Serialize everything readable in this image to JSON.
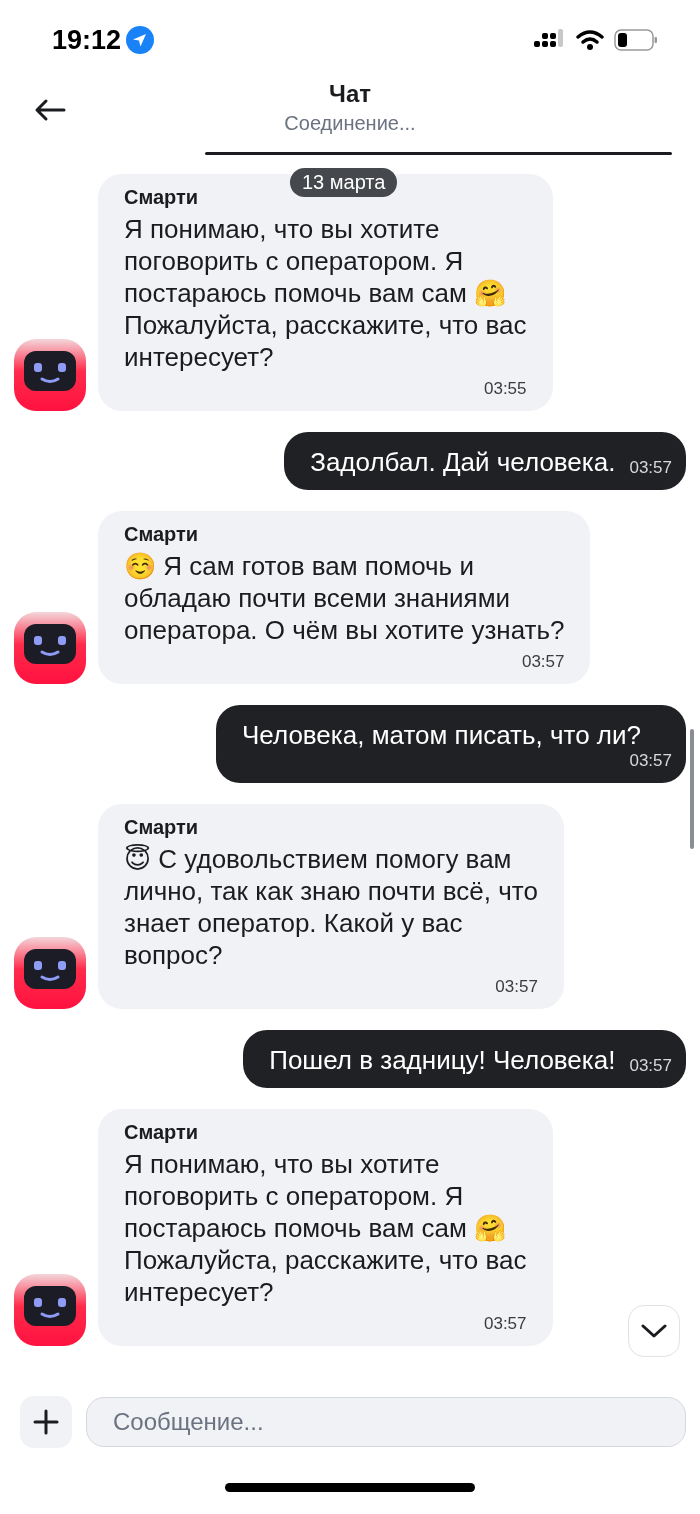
{
  "status_bar": {
    "time": "19:12"
  },
  "header": {
    "title": "Чат",
    "subtitle": "Соединение..."
  },
  "date_label": "13 марта",
  "messages": [
    {
      "kind": "bot",
      "sender": "Смарти",
      "text": "Я понимаю, что вы хотите\nпоговорить с оператором. Я\nпостараюсь помочь вам сам 🤗\nПожалуйста, расскажите, что вас\nинтересует?",
      "time": "03:55"
    },
    {
      "kind": "user",
      "text": "Задолбал. Дай человека.",
      "time": "03:57"
    },
    {
      "kind": "bot",
      "sender": "Смарти",
      "text": "☺️ Я сам готов вам помочь и\nобладаю почти всеми знаниями\nоператора. О чём вы хотите узнать?",
      "time": "03:57"
    },
    {
      "kind": "user",
      "text": "Человека, матом писать, что ли?",
      "time": "03:57"
    },
    {
      "kind": "bot",
      "sender": "Смарти",
      "text": "😇 С удовольствием помогу вам\nлично, так как знаю почти всё, что\nзнает оператор. Какой у вас\nвопрос?",
      "time": "03:57"
    },
    {
      "kind": "user",
      "text": "Пошел в задницу! Человека!",
      "time": "03:57"
    },
    {
      "kind": "bot",
      "sender": "Смарти",
      "text": "Я понимаю, что вы хотите\nпоговорить с оператором. Я\nпостараюсь помочь вам сам 🤗\nПожалуйста, расскажите, что вас\nинтересует?",
      "time": "03:57"
    }
  ],
  "composer": {
    "placeholder": "Сообщение..."
  }
}
